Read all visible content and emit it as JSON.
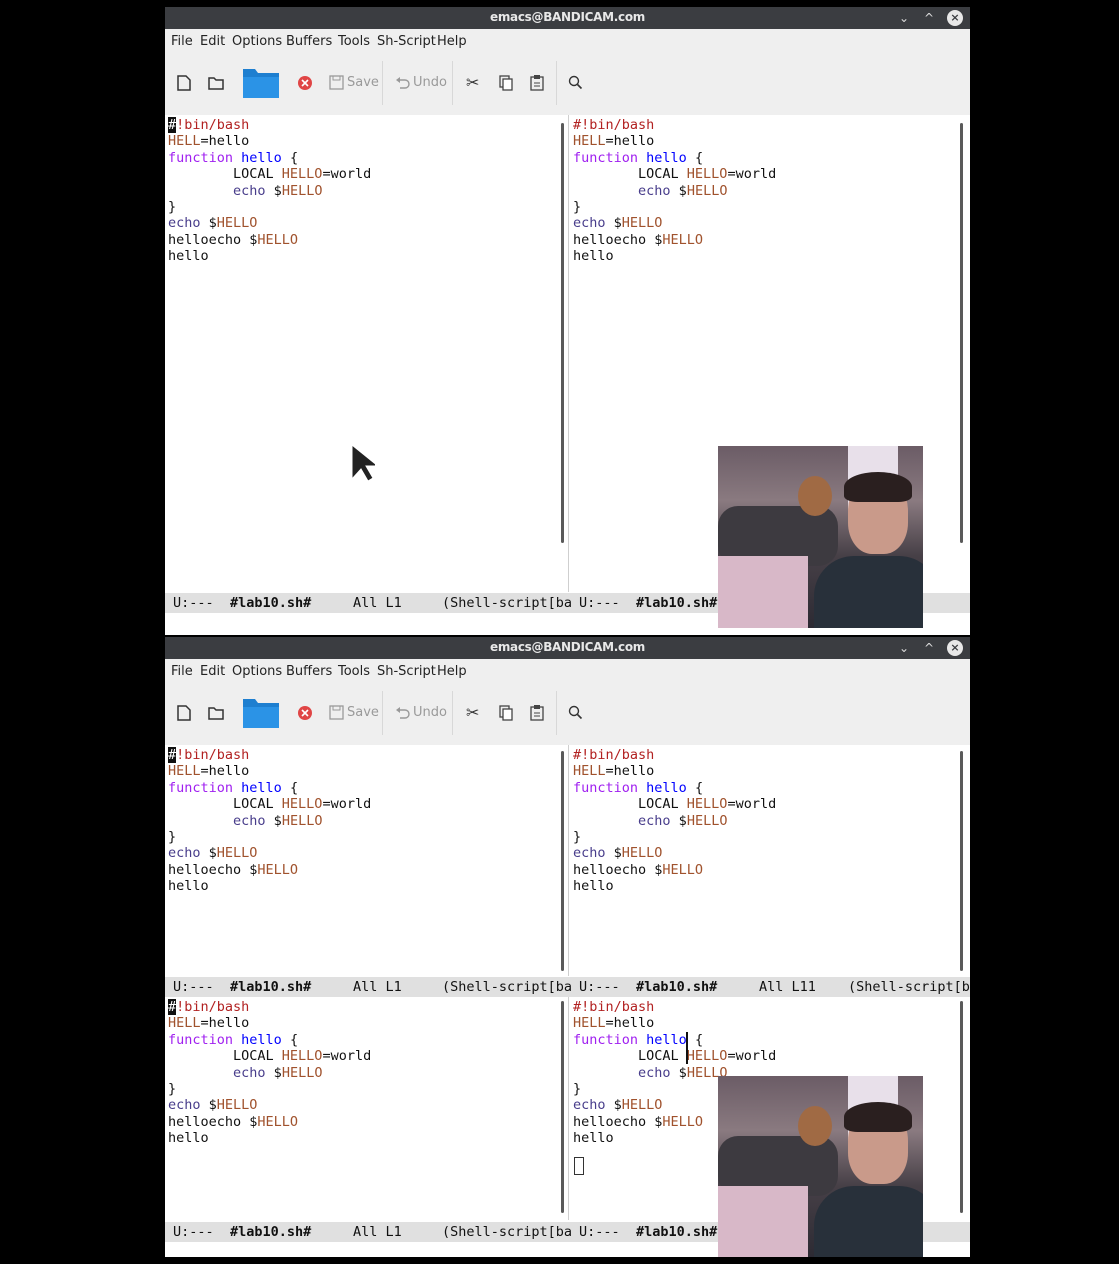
{
  "window": {
    "title": "emacs@BANDICAM.com",
    "controls": {
      "minimize": "⌄",
      "maximize": "^",
      "close": "×"
    }
  },
  "menu": [
    "File",
    "Edit",
    "Options",
    "Buffers",
    "Tools",
    "Sh-Script",
    "Help"
  ],
  "toolbar": {
    "save_label": "Save",
    "undo_label": "Undo",
    "icons": [
      "new-file-icon",
      "open-directory-icon",
      "folder-icon",
      "close-buffer-icon",
      "save-icon",
      "undo-icon",
      "cut-icon",
      "copy-icon",
      "paste-icon",
      "search-icon"
    ]
  },
  "buffer": {
    "lines": [
      "#!bin/bash",
      "HELL=hello",
      "function hello {",
      "        LOCAL HELLO=world",
      "        echo $HELLO",
      "}",
      "echo $HELLO",
      "helloecho $HELLO",
      "hello"
    ]
  },
  "modelines": {
    "top_left": {
      "status": "U:---",
      "name": "#lab10.sh#",
      "pos": "All L1",
      "mode": "(Shell-script[ba"
    },
    "top_right": {
      "status": "U:---",
      "name": "#lab10.sh#",
      "pos": "",
      "mode": ""
    },
    "bottom_upper_left": {
      "status": "U:---",
      "name": "#lab10.sh#",
      "pos": "All L1",
      "mode": "(Shell-script[ba"
    },
    "bottom_upper_right": {
      "status": "U:---",
      "name": "#lab10.sh#",
      "pos": "All L11",
      "mode": "(Shell-script[b"
    },
    "bottom_lower_left": {
      "status": "U:---",
      "name": "#lab10.sh#",
      "pos": "All L1",
      "mode": "(Shell-script[ba"
    },
    "bottom_lower_right": {
      "status": "U:---",
      "name": "#lab10.sh#",
      "pos": "",
      "mode": ""
    }
  },
  "colors": {
    "comment": "#b22222",
    "variable": "#a0522d",
    "keyword": "#a020f0",
    "function_name": "#0000ff",
    "builtin": "#483d8b",
    "titlebar": "#3b3d41",
    "modeline": "#e0e0e0"
  }
}
